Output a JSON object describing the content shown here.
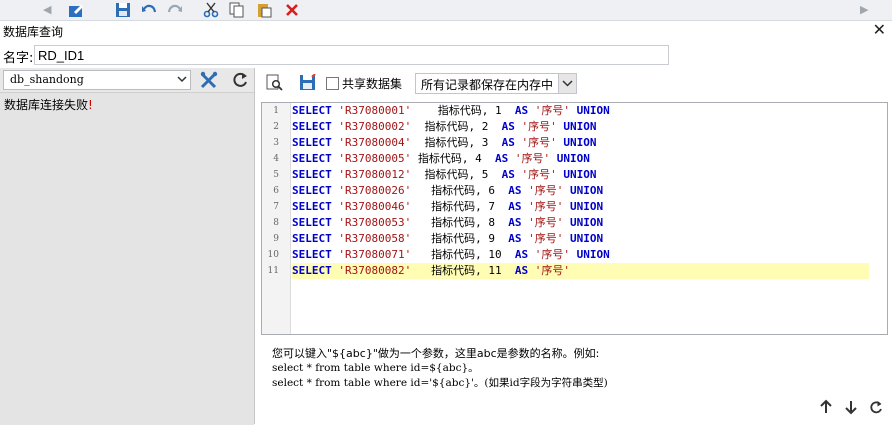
{
  "dialog": {
    "title": "数据库查询",
    "close_icon": "close-icon"
  },
  "name_field": {
    "label": "名字:",
    "value": "RD_ID1"
  },
  "left": {
    "db_select": {
      "value": "db_shandong",
      "arrow_icon": "chevron-down-icon"
    },
    "tool_icon": "connection-settings-icon",
    "refresh_icon": "refresh-icon",
    "error_message": "数据库连接失败",
    "error_mark": "!"
  },
  "right": {
    "preview_icon": "preview-icon",
    "save_icon": "save-icon",
    "share_label": "共享数据集",
    "share_checked": false,
    "mode_select": {
      "value": "所有记录都保存在内存中"
    }
  },
  "editor": {
    "line_numbers": [
      "1",
      "2",
      "3",
      "4",
      "5",
      "6",
      "7",
      "8",
      "9",
      "10",
      "11"
    ],
    "lines": [
      {
        "kw1": "SELECT",
        "code": "'R37080001'",
        "gap": "    ",
        "cn": "指标代码",
        "num": ", 1  ",
        "kw2": "AS",
        "alias": "'序号'",
        "kw3": "UNION"
      },
      {
        "kw1": "SELECT",
        "code": "'R37080002'",
        "gap": "  ",
        "cn": "指标代码",
        "num": ", 2  ",
        "kw2": "AS",
        "alias": "'序号'",
        "kw3": "UNION"
      },
      {
        "kw1": "SELECT",
        "code": "'R37080004'",
        "gap": "  ",
        "cn": "指标代码",
        "num": ", 3  ",
        "kw2": "AS",
        "alias": "'序号'",
        "kw3": "UNION"
      },
      {
        "kw1": "SELECT",
        "code": "'R37080005'",
        "gap": " ",
        "cn": "指标代码",
        "num": ", 4  ",
        "kw2": "AS",
        "alias": "'序号'",
        "kw3": "UNION"
      },
      {
        "kw1": "SELECT",
        "code": "'R37080012'",
        "gap": "  ",
        "cn": "指标代码",
        "num": ", 5  ",
        "kw2": "AS",
        "alias": "'序号'",
        "kw3": "UNION"
      },
      {
        "kw1": "SELECT",
        "code": "'R37080026'",
        "gap": "   ",
        "cn": "指标代码",
        "num": ", 6  ",
        "kw2": "AS",
        "alias": "'序号'",
        "kw3": "UNION"
      },
      {
        "kw1": "SELECT",
        "code": "'R37080046'",
        "gap": "   ",
        "cn": "指标代码",
        "num": ", 7  ",
        "kw2": "AS",
        "alias": "'序号'",
        "kw3": "UNION"
      },
      {
        "kw1": "SELECT",
        "code": "'R37080053'",
        "gap": "   ",
        "cn": "指标代码",
        "num": ", 8  ",
        "kw2": "AS",
        "alias": "'序号'",
        "kw3": "UNION"
      },
      {
        "kw1": "SELECT",
        "code": "'R37080058'",
        "gap": "   ",
        "cn": "指标代码",
        "num": ", 9  ",
        "kw2": "AS",
        "alias": "'序号'",
        "kw3": "UNION"
      },
      {
        "kw1": "SELECT",
        "code": "'R37080071'",
        "gap": "   ",
        "cn": "指标代码",
        "num": ", 10  ",
        "kw2": "AS",
        "alias": "'序号'",
        "kw3": "UNION"
      },
      {
        "kw1": "SELECT",
        "code": "'R37080082'",
        "gap": "   ",
        "cn": "指标代码",
        "num": ", 11  ",
        "kw2": "AS",
        "alias": "'序号'",
        "kw3": ""
      }
    ],
    "highlighted_line": 11
  },
  "hint": {
    "line1": "您可以键入\"${abc}\"做为一个参数，这里abc是参数的名称。例如:",
    "line2": "select * from table where id=${abc}。",
    "line3": "select * from table where id='${abc}'。(如果id字段为字符串类型)"
  },
  "bottom_icons": [
    "arrow-up-icon",
    "arrow-down-icon",
    "refresh-icon"
  ],
  "colors": {
    "keyword": "#0000cc",
    "string": "#a31515",
    "highlight": "#fefdb3",
    "error_mark": "#cc0000"
  }
}
